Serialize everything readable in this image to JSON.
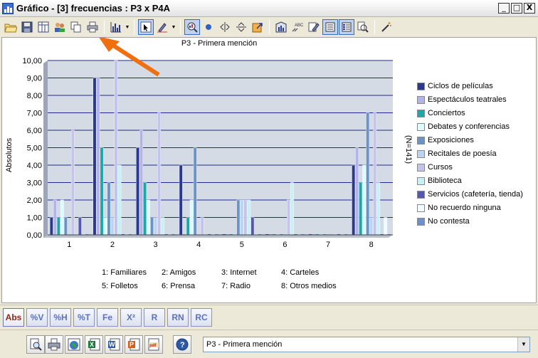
{
  "window": {
    "title": "Gráfico - [3] frecuencias : P3 x P4A",
    "minimize": "_",
    "maximize": "□",
    "close": "X"
  },
  "toolbar": {
    "icons": [
      "open-icon",
      "save-icon",
      "table-icon",
      "users-icon",
      "copy-icon",
      "print-icon",
      "bar-chart-icon",
      "cursor-icon",
      "pen-icon",
      "zoom-tool-icon",
      "dot-icon",
      "mirror-horizontal-icon",
      "mirror-vertical-icon",
      "export-icon",
      "chart-settings-icon",
      "abc-icon",
      "edit-icon",
      "list-icon",
      "list-active-icon",
      "find-icon",
      "wand-icon"
    ]
  },
  "chart_data": {
    "type": "bar",
    "title": "P3 - Primera mención",
    "ylabel": "Absolutos",
    "right_label": "(N=141)",
    "ylim": [
      0,
      10
    ],
    "yticks": [
      "0,00",
      "1,00",
      "2,00",
      "3,00",
      "4,00",
      "5,00",
      "6,00",
      "7,00",
      "8,00",
      "9,00",
      "10,00"
    ],
    "categories": [
      "1",
      "2",
      "3",
      "4",
      "5",
      "6",
      "7",
      "8"
    ],
    "grid": true,
    "legend_position": "right",
    "series": [
      {
        "name": "Ciclos de películas",
        "color": "#2a3990",
        "values": [
          1,
          9,
          5,
          4,
          0,
          0,
          0,
          4
        ]
      },
      {
        "name": "Espectáculos teatrales",
        "color": "#b3b3ea",
        "values": [
          2,
          9,
          6,
          0,
          0,
          0,
          0,
          5
        ]
      },
      {
        "name": "Conciertos",
        "color": "#1aa8a8",
        "values": [
          1,
          5,
          3,
          1,
          0,
          0,
          0,
          3
        ]
      },
      {
        "name": "Debates y conferencias",
        "color": "#dafcff",
        "values": [
          2,
          1,
          2,
          2,
          0,
          0,
          0,
          4
        ]
      },
      {
        "name": "Exposiciones",
        "color": "#6a93c8",
        "values": [
          1,
          3,
          1,
          5,
          2,
          0,
          0,
          7
        ]
      },
      {
        "name": "Recitales de poesía",
        "color": "#bcd4f4",
        "values": [
          0,
          1,
          1,
          0,
          2,
          0,
          0,
          1
        ]
      },
      {
        "name": "Cursos",
        "color": "#c3c3ee",
        "values": [
          6,
          10,
          7,
          1,
          2,
          2,
          0,
          7
        ]
      },
      {
        "name": "Biblioteca",
        "color": "#c6f2f6",
        "values": [
          0,
          4,
          1,
          0,
          2,
          3,
          0,
          3
        ]
      },
      {
        "name": "Servicios (cafetería, tienda)",
        "color": "#5656b8",
        "values": [
          1,
          0,
          0,
          0,
          1,
          0,
          0,
          0
        ]
      },
      {
        "name": "No recuerdo ninguna",
        "color": "#eefcff",
        "values": [
          0,
          0,
          0,
          0,
          0,
          0,
          0,
          1
        ]
      },
      {
        "name": "No contesta",
        "color": "#6d8ed0",
        "values": [
          0,
          0,
          0,
          0,
          0,
          0,
          0,
          0
        ]
      }
    ],
    "category_labels": [
      {
        "num": "1:",
        "label": "Familiares"
      },
      {
        "num": "2:",
        "label": "Amigos"
      },
      {
        "num": "3:",
        "label": "Internet"
      },
      {
        "num": "4:",
        "label": "Carteles"
      },
      {
        "num": "5:",
        "label": "Folletos"
      },
      {
        "num": "6:",
        "label": "Prensa"
      },
      {
        "num": "7:",
        "label": "Radio"
      },
      {
        "num": "8:",
        "label": "Otros medios"
      }
    ]
  },
  "bottom_tabs": [
    {
      "label": "Abs",
      "active": true
    },
    {
      "label": "%V",
      "active": false
    },
    {
      "label": "%H",
      "active": false
    },
    {
      "label": "%T",
      "active": false
    },
    {
      "label": "Fe",
      "active": false
    },
    {
      "label": "X²",
      "active": false
    },
    {
      "label": "R",
      "active": false
    },
    {
      "label": "RN",
      "active": false
    },
    {
      "label": "RC",
      "active": false
    }
  ],
  "bottom_bar": {
    "buttons": [
      "preview-icon",
      "printer-icon",
      "web-icon",
      "excel-icon",
      "word-icon",
      "powerpoint-icon",
      "pdf-icon",
      "help-icon"
    ],
    "select_value": "P3 - Primera mención"
  },
  "colors": {
    "plot_bg": "#d4dbe5",
    "grid": "#1f2a8c",
    "annotation_arrow": "#f07010"
  }
}
